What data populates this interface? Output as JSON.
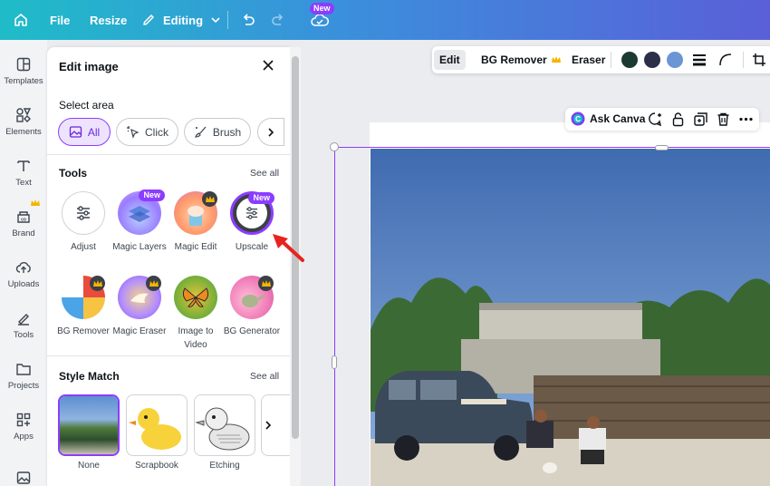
{
  "topbar": {
    "file": "File",
    "resize": "Resize",
    "editing": "Editing",
    "new_badge": "New"
  },
  "rail": [
    {
      "label": "Templates",
      "icon": "templates-icon"
    },
    {
      "label": "Elements",
      "icon": "elements-icon"
    },
    {
      "label": "Text",
      "icon": "text-icon"
    },
    {
      "label": "Brand",
      "icon": "brand-icon"
    },
    {
      "label": "Uploads",
      "icon": "uploads-icon"
    },
    {
      "label": "Tools",
      "icon": "tools-icon"
    },
    {
      "label": "Projects",
      "icon": "projects-icon"
    },
    {
      "label": "Apps",
      "icon": "apps-icon"
    }
  ],
  "panel": {
    "title": "Edit image",
    "select_area": "Select area",
    "chips": {
      "all": "All",
      "click": "Click",
      "brush": "Brush"
    },
    "tools_heading": "Tools",
    "tools_see_all": "See all",
    "tools": [
      {
        "label": "Adjust",
        "badge": ""
      },
      {
        "label": "Magic Layers",
        "badge": "New"
      },
      {
        "label": "Magic Edit",
        "badge": "crown"
      },
      {
        "label": "Upscale",
        "badge": "New"
      },
      {
        "label": "BG Remover",
        "badge": "crown"
      },
      {
        "label": "Magic Eraser",
        "badge": "crown"
      },
      {
        "label": "Image to Video",
        "badge": ""
      },
      {
        "label": "BG Generator",
        "badge": "crown"
      }
    ],
    "style_heading": "Style Match",
    "style_see_all": "See all",
    "styles": [
      {
        "label": "None"
      },
      {
        "label": "Scrapbook"
      },
      {
        "label": "Etching"
      }
    ]
  },
  "context_bar": {
    "edit": "Edit",
    "bg_remover": "BG Remover",
    "eraser": "Eraser",
    "swatches": [
      "#1b3b32",
      "#2b2f48",
      "#6a96d6"
    ]
  },
  "float_bar": {
    "ask_canva": "Ask Canva"
  },
  "colors": {
    "accent": "#8b3dff",
    "arrow": "#e8231e"
  }
}
